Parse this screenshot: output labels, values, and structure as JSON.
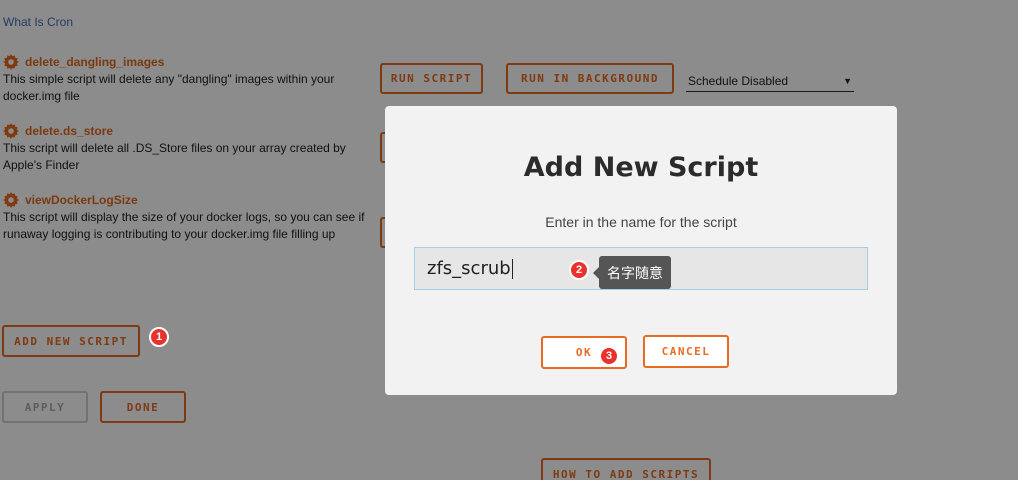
{
  "top_link": "What Is Cron",
  "scripts": [
    {
      "name": "delete_dangling_images",
      "description": "This simple script will delete any \"dangling\" images within your docker.img file"
    },
    {
      "name": "delete.ds_store",
      "description": "This script will delete all .DS_Store files on your array created by Apple's Finder"
    },
    {
      "name": "viewDockerLogSize",
      "description": "This script will display the size of your docker logs, so you can see if runaway logging is contributing to your docker.img file filling up"
    }
  ],
  "row_buttons": {
    "run_script": "RUN SCRIPT",
    "run_in_background": "RUN IN BACKGROUND"
  },
  "schedule_select": {
    "value": "Schedule Disabled"
  },
  "page_buttons": {
    "add_new_script": "ADD NEW SCRIPT",
    "apply": "APPLY",
    "done": "DONE",
    "how_to_add_scripts": "HOW TO ADD SCRIPTS"
  },
  "modal": {
    "title": "Add New Script",
    "prompt": "Enter in the name for the script",
    "input_value": "zfs_scrub",
    "ok": "OK",
    "cancel": "CANCEL"
  },
  "annotations": {
    "step1": "1",
    "step2": "2",
    "step3": "3",
    "tooltip": "名字随意"
  },
  "colors": {
    "accent": "#e86b22",
    "badge": "#e8322b",
    "link": "#486dba"
  },
  "icons": [
    "gear-icon",
    "chevron-down-icon"
  ]
}
